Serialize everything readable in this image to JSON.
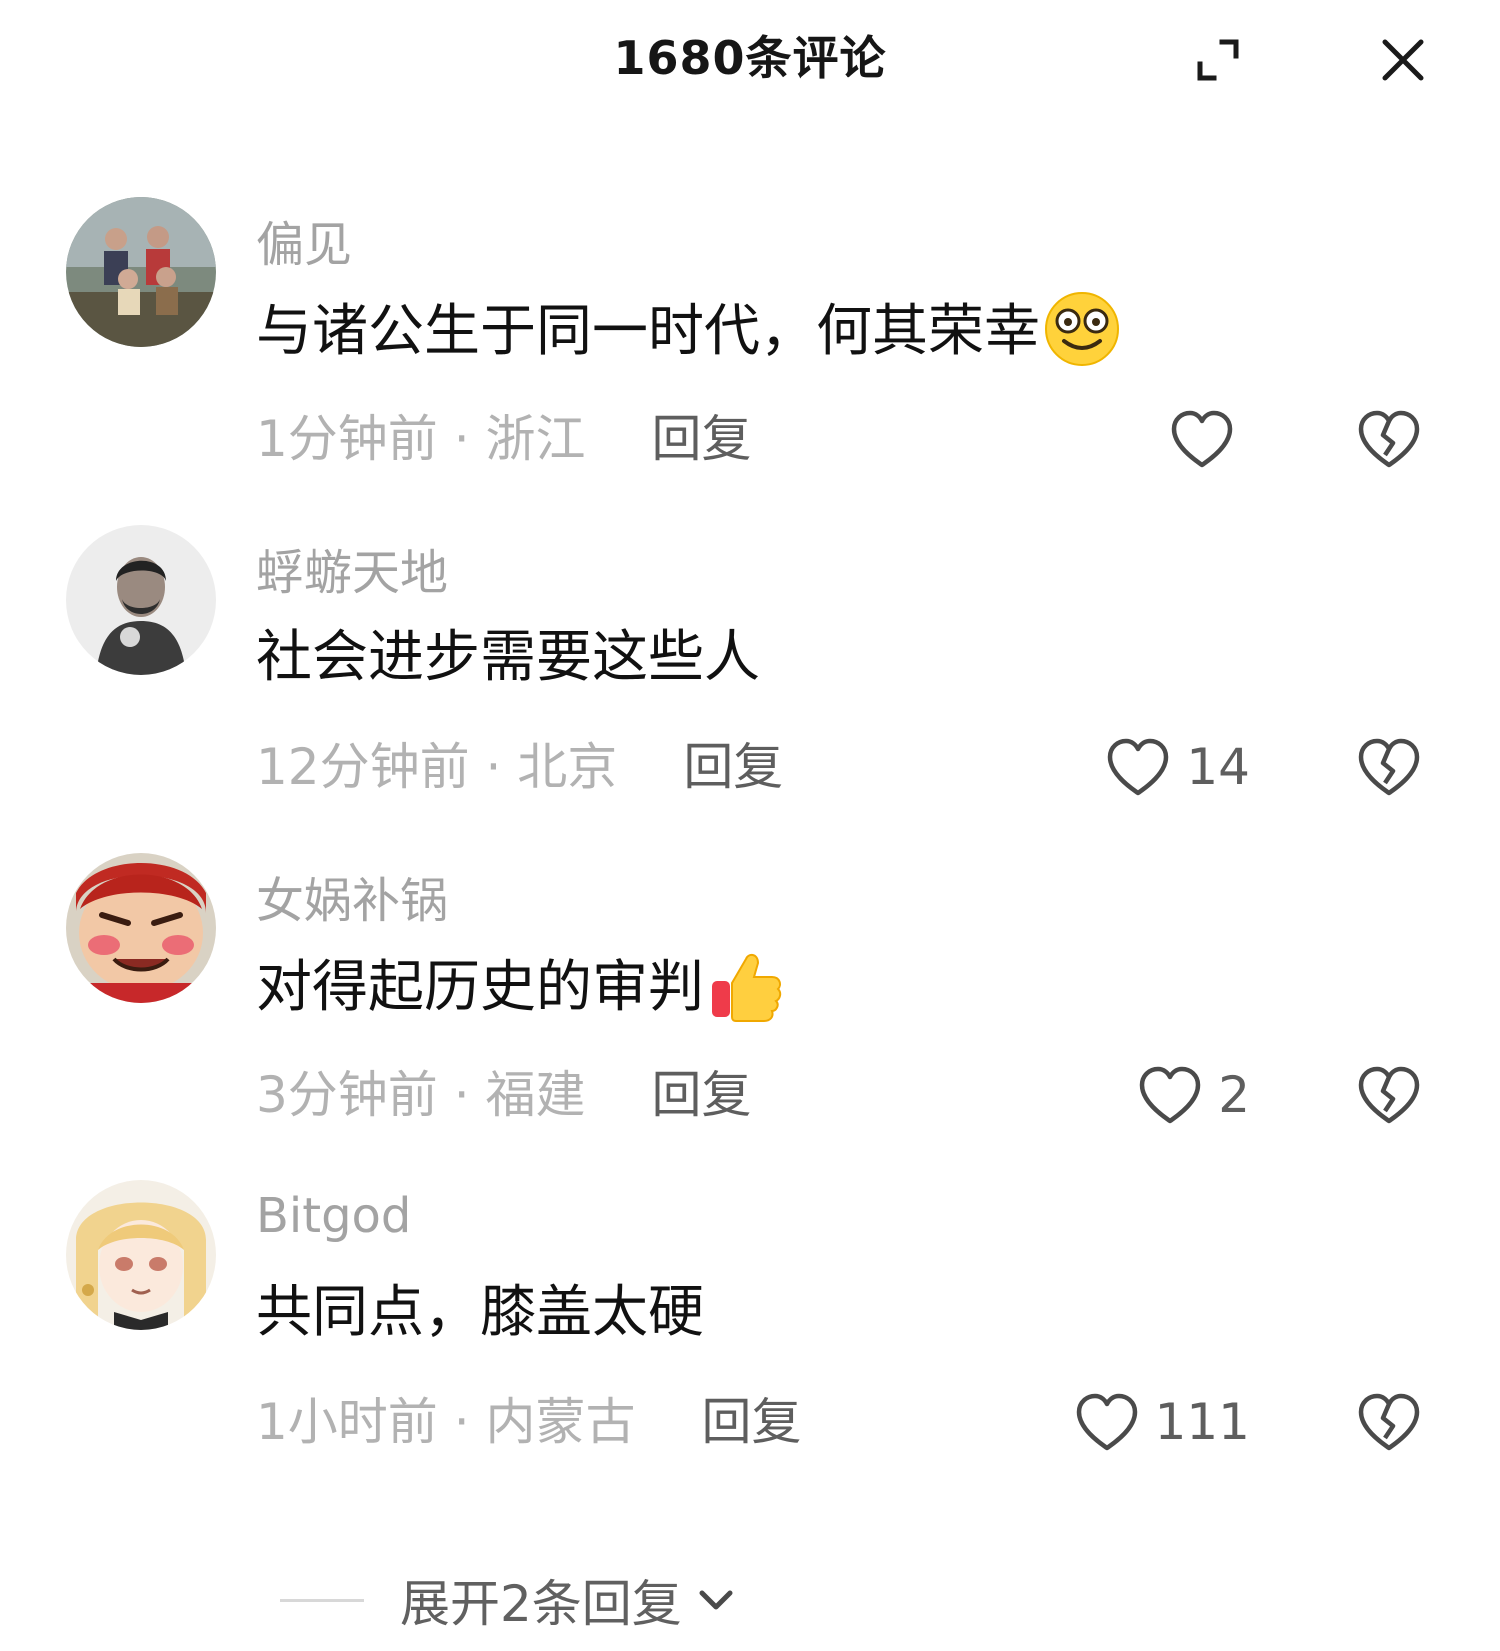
{
  "header": {
    "title": "1680条评论"
  },
  "comments": [
    {
      "username": "偏见",
      "text": "与诸公生于同一时代，何其荣幸",
      "emoji": "smile-emoji",
      "time_location": "1分钟前 · 浙江",
      "reply_label": "回复",
      "like_count": ""
    },
    {
      "username": "蜉蝣天地",
      "text": "社会进步需要这些人",
      "emoji": "",
      "time_location": "12分钟前 · 北京",
      "reply_label": "回复",
      "like_count": "14"
    },
    {
      "username": "女娲补锅",
      "text": "对得起历史的审判",
      "emoji": "thumbs-up-emoji",
      "time_location": "3分钟前 · 福建",
      "reply_label": "回复",
      "like_count": "2"
    },
    {
      "username": "Bitgod",
      "text": "共同点，膝盖太硬",
      "emoji": "",
      "time_location": "1小时前 · 内蒙古",
      "reply_label": "回复",
      "like_count": "111"
    }
  ],
  "expand_replies": {
    "label": "展开2条回复"
  },
  "icons": {
    "expand": "expand-icon",
    "close": "close-icon",
    "like": "heart-icon",
    "dislike": "broken-heart-icon",
    "chevron": "chevron-down-icon"
  },
  "colors": {
    "username": "#a3a3a3",
    "meta": "#b2b2b2",
    "reply": "#5e5e5e",
    "text": "#111111"
  }
}
